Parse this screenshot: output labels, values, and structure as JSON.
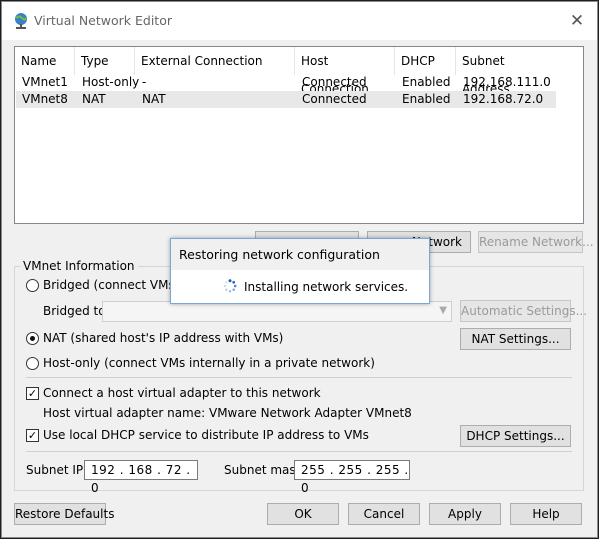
{
  "window": {
    "title": "Virtual Network Editor"
  },
  "table": {
    "headers": [
      "Name",
      "Type",
      "External Connection",
      "Host Connection",
      "DHCP",
      "Subnet Address"
    ],
    "rows": [
      [
        "VMnet1",
        "Host-only",
        "-",
        "Connected",
        "Enabled",
        "192.168.111.0"
      ],
      [
        "VMnet8",
        "NAT",
        "NAT",
        "Connected",
        "Enabled",
        "192.168.72.0"
      ]
    ],
    "selected_row": 1
  },
  "actions": {
    "add_network_visible": "Network",
    "rename_network": "Rename Network..."
  },
  "vmnet_info": {
    "group_label": "VMnet Information",
    "bridged_label": "Bridged (connect VMs direc",
    "bridged_to_label": "Bridged to:",
    "automatic_settings": "Automatic Settings...",
    "nat_label": "NAT (shared host's IP address with VMs)",
    "nat_settings": "NAT Settings...",
    "hostonly_label": "Host-only (connect VMs internally in a private network)",
    "connect_adapter_label": "Connect a host virtual adapter to this network",
    "adapter_name_label": "Host virtual adapter name: VMware Network Adapter VMnet8",
    "dhcp_label": "Use local DHCP service to distribute IP address to VMs",
    "dhcp_settings": "DHCP Settings...",
    "subnet_ip_label": "Subnet IP:",
    "subnet_ip_value": "192 . 168 . 72 . 0",
    "subnet_mask_label": "Subnet mask:",
    "subnet_mask_value": "255 . 255 . 255 . 0",
    "selected_mode": "nat",
    "connect_adapter_checked": true,
    "dhcp_checked": true
  },
  "footer": {
    "restore_defaults": "Restore Defaults",
    "ok": "OK",
    "cancel": "Cancel",
    "apply": "Apply",
    "help": "Help"
  },
  "progress_popup": {
    "title": "Restoring network configuration",
    "message": "Installing network services."
  },
  "icons": {
    "title_icon": "network-globe-icon",
    "close_icon": "close-icon",
    "spinner_icon": "spinner-icon",
    "combo_arrow_icon": "chevron-down-icon"
  },
  "colors": {
    "selected_row": "#e8e8e8",
    "popup_border": "#7aa7d9"
  }
}
